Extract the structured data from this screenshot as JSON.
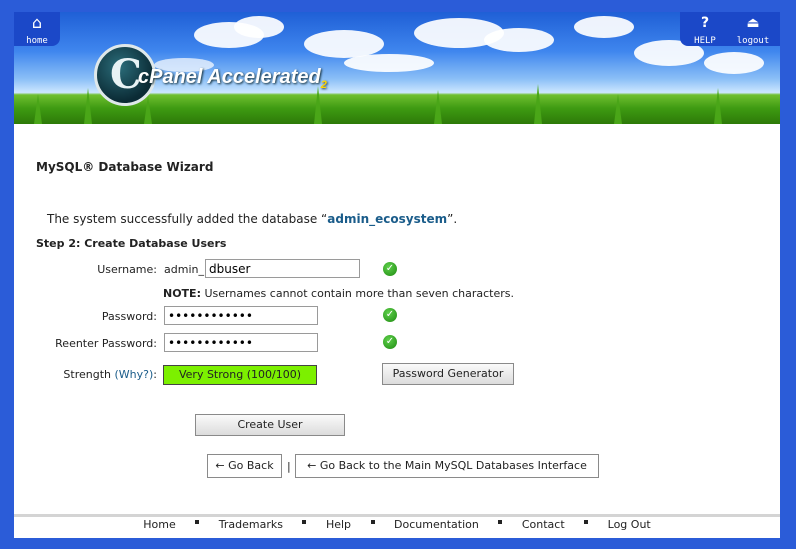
{
  "header": {
    "home_label": "home",
    "help_label": "HELP",
    "logout_label": "logout",
    "logo_name": "cPanel Accelerated",
    "logo_version": "2"
  },
  "page_title": "MySQL® Database Wizard",
  "success": {
    "prefix": "The system successfully added the database “",
    "db_name": "admin_ecosystem",
    "suffix": "”."
  },
  "step_heading": "Step 2: Create Database Users",
  "form": {
    "username_label": "Username:",
    "username_prefix": "admin_",
    "username_value": "dbuser",
    "note_bold": "NOTE:",
    "note_text": " Usernames cannot contain more than seven characters.",
    "password_label": "Password:",
    "password_value": "************",
    "reenter_label": "Reenter Password:",
    "reenter_value": "************",
    "strength_label": "Strength",
    "why_link": "(Why?)",
    "strength_colon": ":",
    "strength_value": "Very Strong (100/100)",
    "generator_button": "Password Generator",
    "create_button": "Create User"
  },
  "nav": {
    "go_back": "← Go Back",
    "separator": "|",
    "go_back_main": "← Go Back to the Main MySQL Databases Interface"
  },
  "footer": {
    "links": [
      "Home",
      "Trademarks",
      "Help",
      "Documentation",
      "Contact",
      "Log Out"
    ]
  },
  "colors": {
    "outer_border": "#2b5cd8",
    "strength_fill": "#7cf000",
    "db_name_color": "#1a5c8a"
  }
}
